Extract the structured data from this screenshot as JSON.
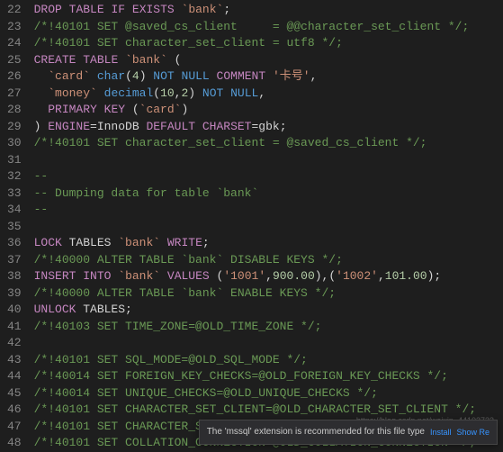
{
  "lineStart": 22,
  "lines": [
    [
      [
        "kw",
        "DROP"
      ],
      [
        "op",
        " "
      ],
      [
        "kw",
        "TABLE"
      ],
      [
        "op",
        " "
      ],
      [
        "kw",
        "IF"
      ],
      [
        "op",
        " "
      ],
      [
        "kw",
        "EXISTS"
      ],
      [
        "op",
        " "
      ],
      [
        "str",
        "`bank`"
      ],
      [
        "op",
        ";"
      ]
    ],
    [
      [
        "cmt",
        "/*!40101 SET @saved_cs_client     = @@character_set_client */;"
      ]
    ],
    [
      [
        "cmt",
        "/*!40101 SET character_set_client = utf8 */;"
      ]
    ],
    [
      [
        "kw",
        "CREATE"
      ],
      [
        "op",
        " "
      ],
      [
        "kw",
        "TABLE"
      ],
      [
        "op",
        " "
      ],
      [
        "str",
        "`bank`"
      ],
      [
        "op",
        " ("
      ]
    ],
    [
      [
        "op",
        "  "
      ],
      [
        "str",
        "`card`"
      ],
      [
        "op",
        " "
      ],
      [
        "typ",
        "char"
      ],
      [
        "op",
        "("
      ],
      [
        "num",
        "4"
      ],
      [
        "op",
        ") "
      ],
      [
        "kw2",
        "NOT"
      ],
      [
        "op",
        " "
      ],
      [
        "kw2",
        "NULL"
      ],
      [
        "op",
        " "
      ],
      [
        "kw",
        "COMMENT"
      ],
      [
        "op",
        " "
      ],
      [
        "str",
        "'卡号'"
      ],
      [
        "op",
        ","
      ]
    ],
    [
      [
        "op",
        "  "
      ],
      [
        "str",
        "`money`"
      ],
      [
        "op",
        " "
      ],
      [
        "typ",
        "decimal"
      ],
      [
        "op",
        "("
      ],
      [
        "num",
        "10"
      ],
      [
        "op",
        ","
      ],
      [
        "num",
        "2"
      ],
      [
        "op",
        ") "
      ],
      [
        "kw2",
        "NOT"
      ],
      [
        "op",
        " "
      ],
      [
        "kw2",
        "NULL"
      ],
      [
        "op",
        ","
      ]
    ],
    [
      [
        "op",
        "  "
      ],
      [
        "kw",
        "PRIMARY"
      ],
      [
        "op",
        " "
      ],
      [
        "kw",
        "KEY"
      ],
      [
        "op",
        " ("
      ],
      [
        "str",
        "`card`"
      ],
      [
        "op",
        ")"
      ]
    ],
    [
      [
        "op",
        ") "
      ],
      [
        "kw",
        "ENGINE"
      ],
      [
        "op",
        "=InnoDB "
      ],
      [
        "kw",
        "DEFAULT"
      ],
      [
        "op",
        " "
      ],
      [
        "kw",
        "CHARSET"
      ],
      [
        "op",
        "=gbk;"
      ]
    ],
    [
      [
        "cmt",
        "/*!40101 SET character_set_client = @saved_cs_client */;"
      ]
    ],
    [],
    [
      [
        "cmt",
        "--"
      ]
    ],
    [
      [
        "cmt",
        "-- Dumping data for table `bank`"
      ]
    ],
    [
      [
        "cmt",
        "--"
      ]
    ],
    [],
    [
      [
        "kw",
        "LOCK"
      ],
      [
        "op",
        " TABLES "
      ],
      [
        "str",
        "`bank`"
      ],
      [
        "op",
        " "
      ],
      [
        "kw",
        "WRITE"
      ],
      [
        "op",
        ";"
      ]
    ],
    [
      [
        "cmt",
        "/*!40000 ALTER TABLE `bank` DISABLE KEYS */;"
      ]
    ],
    [
      [
        "kw",
        "INSERT"
      ],
      [
        "op",
        " "
      ],
      [
        "kw",
        "INTO"
      ],
      [
        "op",
        " "
      ],
      [
        "str",
        "`bank`"
      ],
      [
        "op",
        " "
      ],
      [
        "kw",
        "VALUES"
      ],
      [
        "op",
        " ("
      ],
      [
        "str",
        "'1001'"
      ],
      [
        "op",
        ","
      ],
      [
        "num",
        "900.00"
      ],
      [
        "op",
        "),("
      ],
      [
        "str",
        "'1002'"
      ],
      [
        "op",
        ","
      ],
      [
        "num",
        "101.00"
      ],
      [
        "op",
        ");"
      ]
    ],
    [
      [
        "cmt",
        "/*!40000 ALTER TABLE `bank` ENABLE KEYS */;"
      ]
    ],
    [
      [
        "kw",
        "UNLOCK"
      ],
      [
        "op",
        " TABLES;"
      ]
    ],
    [
      [
        "cmt",
        "/*!40103 SET TIME_ZONE=@OLD_TIME_ZONE */;"
      ]
    ],
    [],
    [
      [
        "cmt",
        "/*!40101 SET SQL_MODE=@OLD_SQL_MODE */;"
      ]
    ],
    [
      [
        "cmt",
        "/*!40014 SET FOREIGN_KEY_CHECKS=@OLD_FOREIGN_KEY_CHECKS */;"
      ]
    ],
    [
      [
        "cmt",
        "/*!40014 SET UNIQUE_CHECKS=@OLD_UNIQUE_CHECKS */;"
      ]
    ],
    [
      [
        "cmt",
        "/*!40101 SET CHARACTER_SET_CLIENT=@OLD_CHARACTER_SET_CLIENT */;"
      ]
    ],
    [
      [
        "cmt",
        "/*!40101 SET CHARACTER_SET_RESULTS=@OLD_CHARACTER_SET_RESULTS */;"
      ]
    ],
    [
      [
        "cmt",
        "/*!40101 SET COLLATION_CONNECTION=@OLD_COLLATION_CONNECTION */;"
      ]
    ]
  ],
  "toast": {
    "message": "The 'mssql' extension is recommended for this file type",
    "install": "Install",
    "show": "Show Re"
  },
  "watermark": "https://blog.csdn.net/weixin_44103733"
}
